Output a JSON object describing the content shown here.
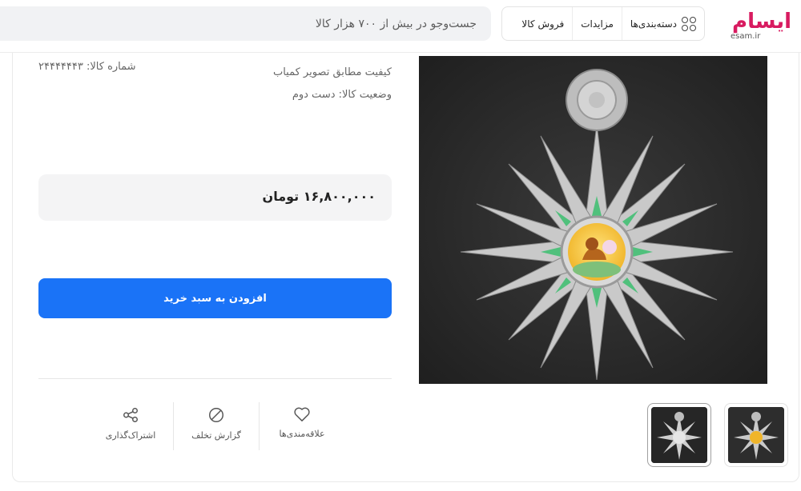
{
  "header": {
    "logo_text": "ایسام",
    "logo_sub": "esam.ir",
    "nav": [
      {
        "label": "دسته‌بندی‌ها"
      },
      {
        "label": "مزایدات"
      },
      {
        "label": "فروش کالا"
      }
    ],
    "search_placeholder": "جست‌وجو در بیش از ۷۰۰ هزار کالا"
  },
  "product": {
    "code": "شماره کالا: ۲۴۴۴۴۴۴۳",
    "quality": "کیفیت مطابق تصویر کمیاب",
    "condition": "وضعیت کالا: دست دوم",
    "price": "۱۶,۸۰۰,۰۰۰ تومان",
    "add_to_cart": "افزودن به سبد خرید"
  },
  "actions": [
    {
      "label": "علاقه‌مندی‌ها",
      "icon": "heart-icon"
    },
    {
      "label": "گزارش تخلف",
      "icon": "forbidden-icon"
    },
    {
      "label": "اشتراک‌گذاری",
      "icon": "share-icon"
    }
  ],
  "colors": {
    "brand": "#d81b60",
    "primary_button": "#1a73f7"
  }
}
